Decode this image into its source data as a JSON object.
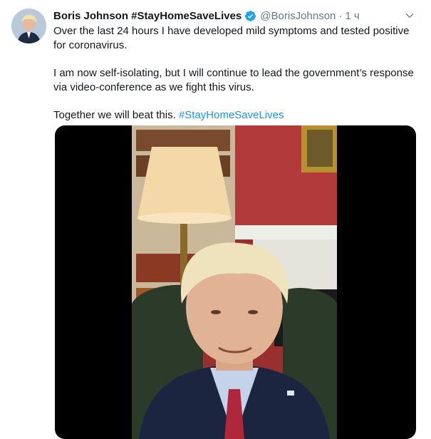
{
  "tweet": {
    "author_name": "Boris Johnson #StayHomeSaveLives",
    "author_handle": "@BorisJohnson",
    "separator": "·",
    "timestamp": "1 ч",
    "paragraphs": [
      "Over the last 24 hours I have developed mild symptoms and tested positive for coronavirus.",
      "I am now self-isolating, but I will continue to lead the government’s response via video-conference as we fight this virus."
    ],
    "closing_text": "Together we will beat this.",
    "closing_hashtag": "#StayHomeSaveLives"
  },
  "colors": {
    "text": "#14171a",
    "secondary": "#657786",
    "link": "#1b95e0",
    "verified": "#1da1f2"
  },
  "icons": {
    "verified": "verified-badge-icon",
    "more": "chevron-down-icon",
    "avatar": "profile-photo"
  }
}
